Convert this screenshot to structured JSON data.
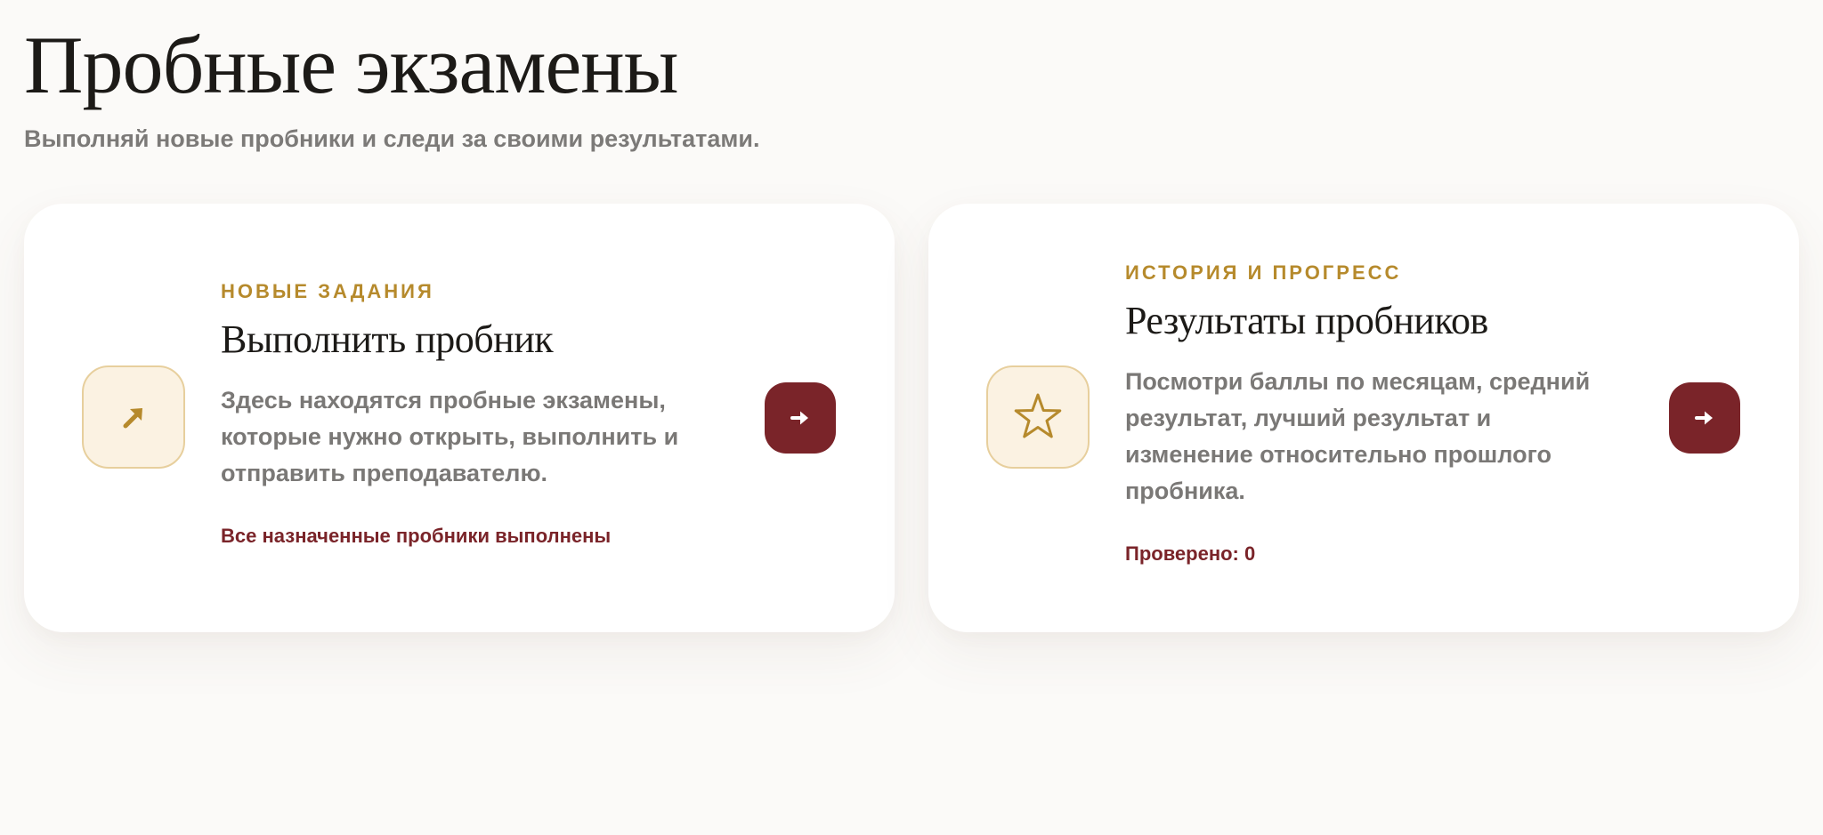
{
  "page": {
    "title": "Пробные экзамены",
    "subtitle": "Выполняй новые пробники и следи за своими результатами."
  },
  "cards": [
    {
      "eyebrow": "НОВЫЕ ЗАДАНИЯ",
      "title": "Выполнить пробник",
      "description": "Здесь находятся пробные экзамены, которые нужно открыть, выполнить и отправить преподавателю.",
      "status": "Все назначенные пробники выполнены",
      "icon": "arrow-up-right-icon",
      "button_icon": "arrow-right-icon"
    },
    {
      "eyebrow": "ИСТОРИЯ И ПРОГРЕСС",
      "title": "Результаты пробников",
      "description": "Посмотри баллы по месяцам, средний результат, лучший результат и изменение относительно прошлого пробника.",
      "status": "Проверено: 0",
      "icon": "star-icon",
      "button_icon": "arrow-right-icon"
    }
  ],
  "colors": {
    "background": "#fbfaf8",
    "accent_gold": "#b68a2c",
    "accent_burgundy": "#7a2429",
    "icon_box_bg": "#fbf2e2",
    "icon_box_border": "#e7cf9d",
    "muted_text": "#7a7876"
  }
}
